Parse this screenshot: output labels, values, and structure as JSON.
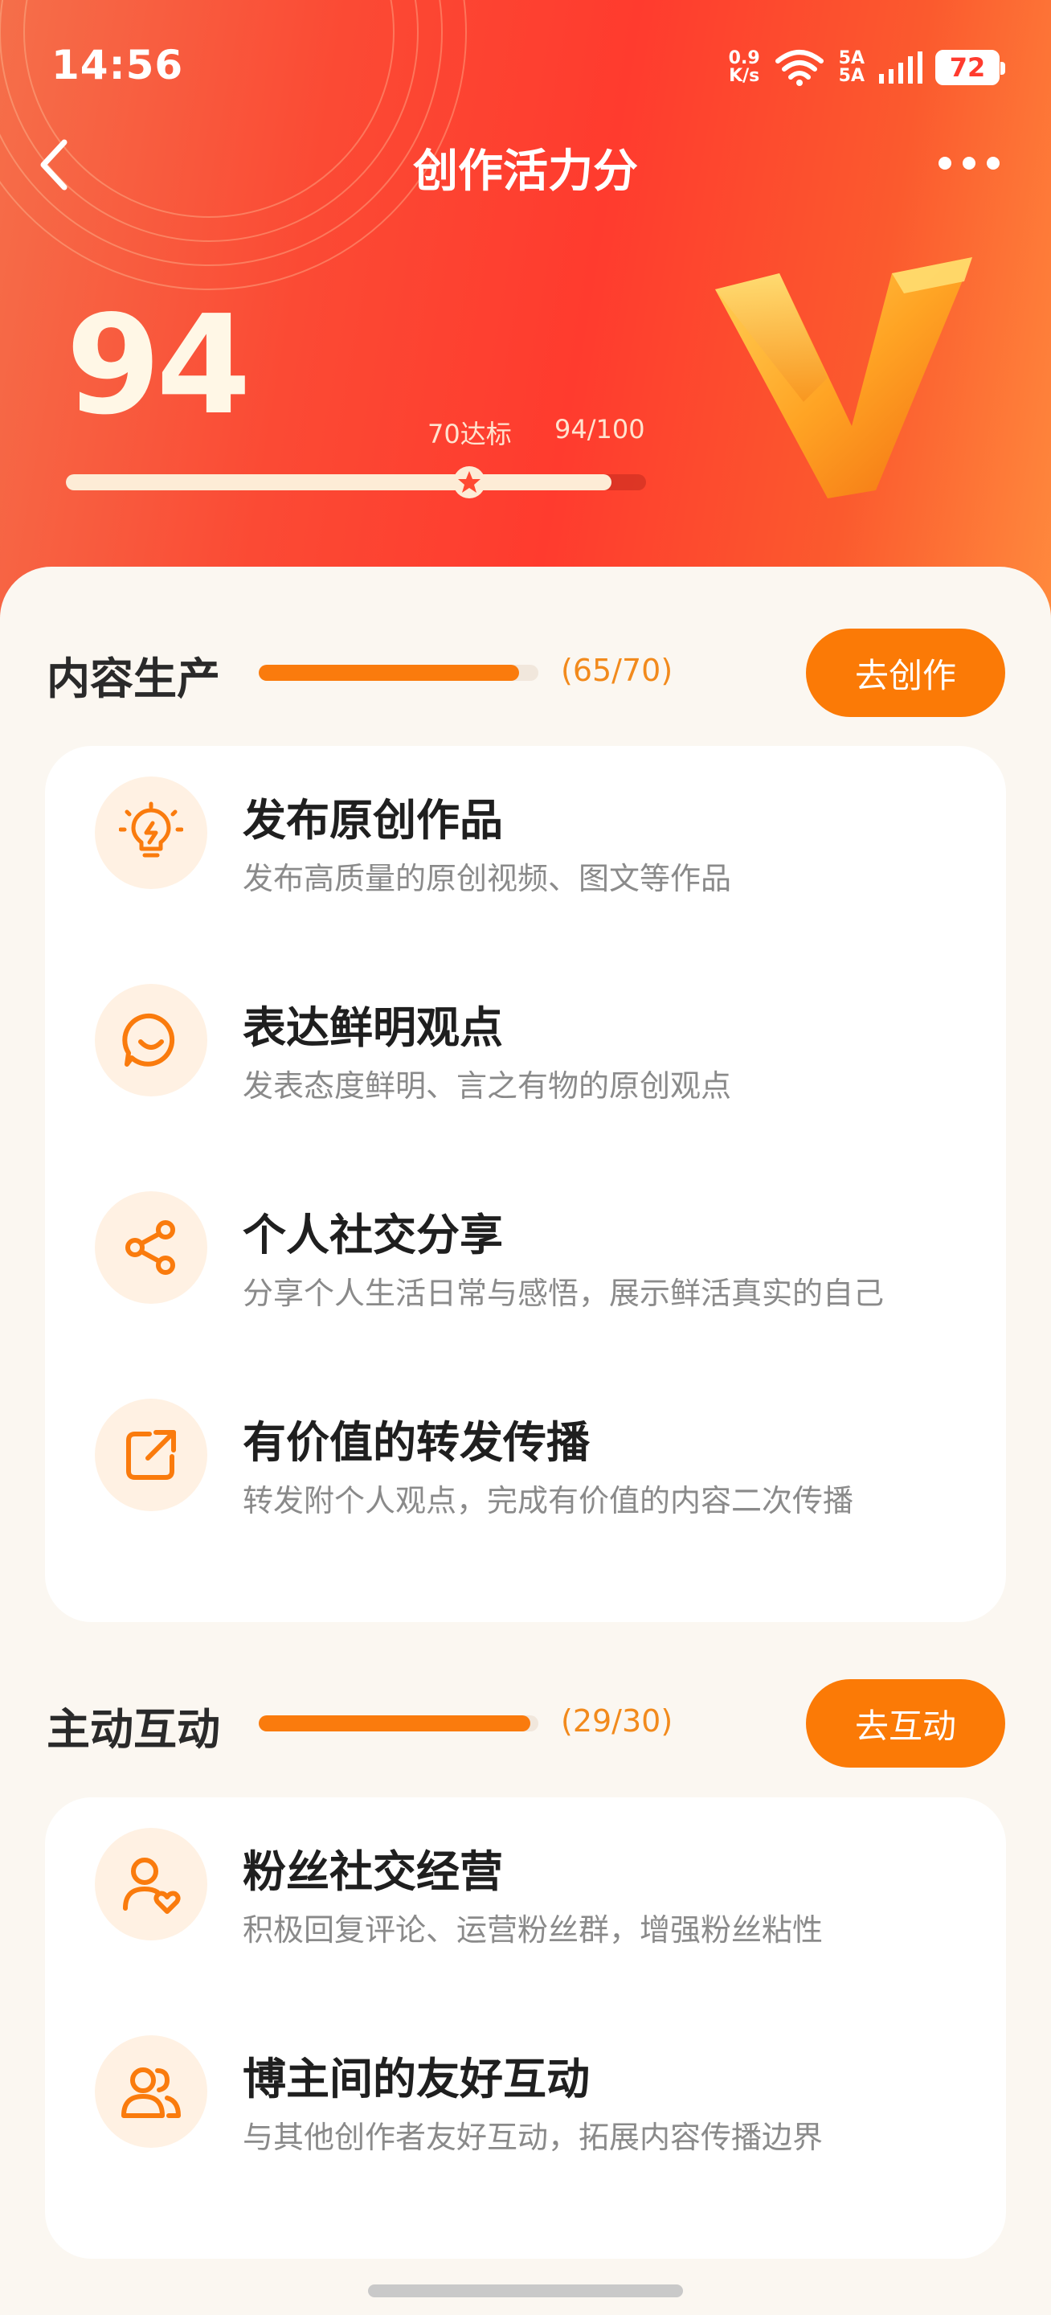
{
  "status_bar": {
    "time": "14:56",
    "net_speed_value": "0.9",
    "net_speed_unit": "K/s",
    "signal_1": "5A",
    "signal_2": "5A",
    "battery": "72"
  },
  "header": {
    "title": "创作活力分",
    "back_icon": "chevron-left-icon",
    "more_icon": "more-dots-icon"
  },
  "score": {
    "value": "94",
    "target_label": "70达标",
    "progress_label": "94/100",
    "progress_fraction": 0.94,
    "target_fraction": 0.7
  },
  "sections": [
    {
      "title": "内容生产",
      "count": "(65/70)",
      "progress_fraction": 0.93,
      "button": "去创作",
      "items": [
        {
          "icon": "lightbulb-icon",
          "title": "发布原创作品",
          "desc": "发布高质量的原创视频、图文等作品"
        },
        {
          "icon": "chat-smile-icon",
          "title": "表达鲜明观点",
          "desc": "发表态度鲜明、言之有物的原创观点"
        },
        {
          "icon": "share-icon",
          "title": "个人社交分享",
          "desc": "分享个人生活日常与感悟，展示鲜活真实的自己"
        },
        {
          "icon": "forward-icon",
          "title": "有价值的转发传播",
          "desc": "转发附个人观点，完成有价值的内容二次传播"
        }
      ]
    },
    {
      "title": "主动互动",
      "count": "(29/30)",
      "progress_fraction": 0.97,
      "button": "去互动",
      "items": [
        {
          "icon": "user-heart-icon",
          "title": "粉丝社交经营",
          "desc": "积极回复评论、运营粉丝群，增强粉丝粘性"
        },
        {
          "icon": "users-icon",
          "title": "博主间的友好互动",
          "desc": "与其他创作者友好互动，拓展内容传播边界"
        }
      ]
    }
  ],
  "colors": {
    "accent": "#fb7a06",
    "hero_red": "#ff3b2e",
    "icon_bg": "#fff1e3"
  }
}
